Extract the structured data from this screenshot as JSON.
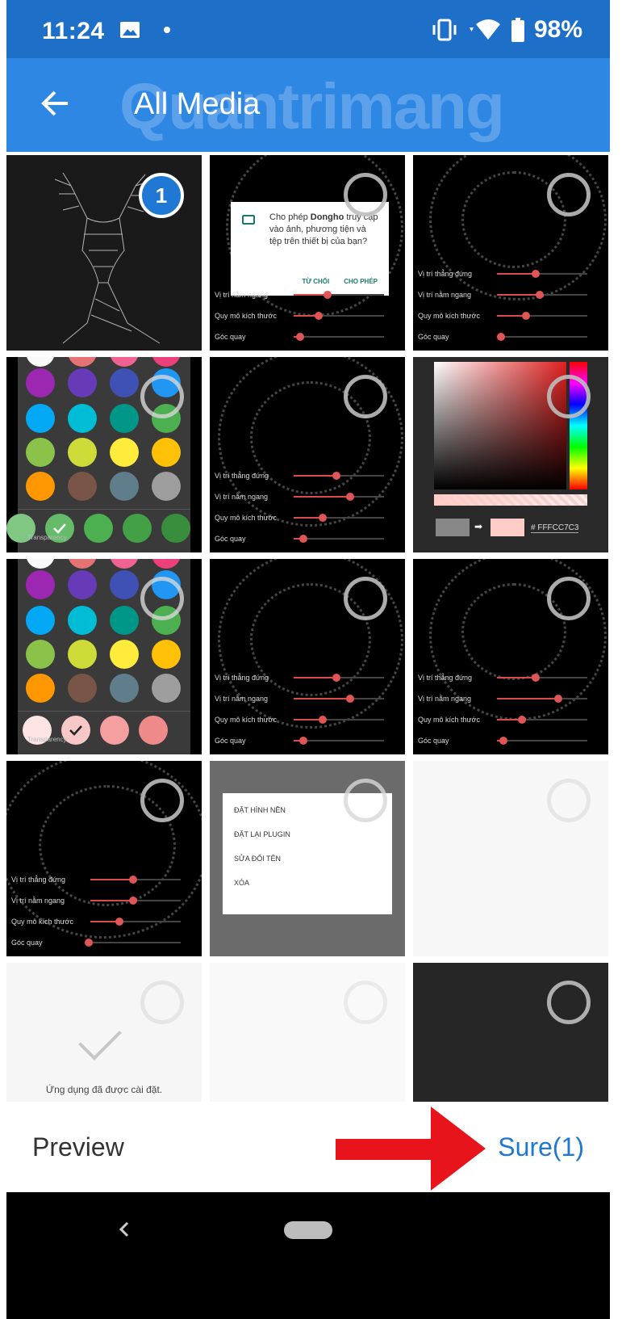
{
  "status_bar": {
    "time": "11:24",
    "battery": "98%"
  },
  "app_bar": {
    "title": "All Media",
    "watermark": "Quantrimang"
  },
  "thumbnails": {
    "badge_count": "1",
    "permission_dialog": {
      "text_prefix": "Cho phép ",
      "app_name": "Dongho",
      "text_suffix": " truy cập vào ảnh, phương tiện và tệp trên thiết bị của bạn?",
      "deny": "TỪ CHỐI",
      "allow": "CHO PHÉP"
    },
    "slider_labels": [
      "Vị trí thẳng đứng",
      "Vị trí nằm ngang",
      "Quy mô kích thước",
      "Góc quay"
    ],
    "transparency_label": "Transparency",
    "hex_value": "# FFFCC7C3",
    "menu_items": [
      "ĐẶT HÌNH NỀN",
      "ĐẶT LẠI PLUGIN",
      "SỬA ĐỔI TÊN",
      "XÓA"
    ],
    "installed_text": "Ứng dụng đã được cài đặt."
  },
  "bottom_bar": {
    "preview_label": "Preview",
    "sure_label": "Sure(1)"
  },
  "colors": {
    "status_bar": "#1d6fc7",
    "app_bar": "#2f87e4",
    "accent": "#1e78d4",
    "arrow_red": "#e8141b"
  }
}
